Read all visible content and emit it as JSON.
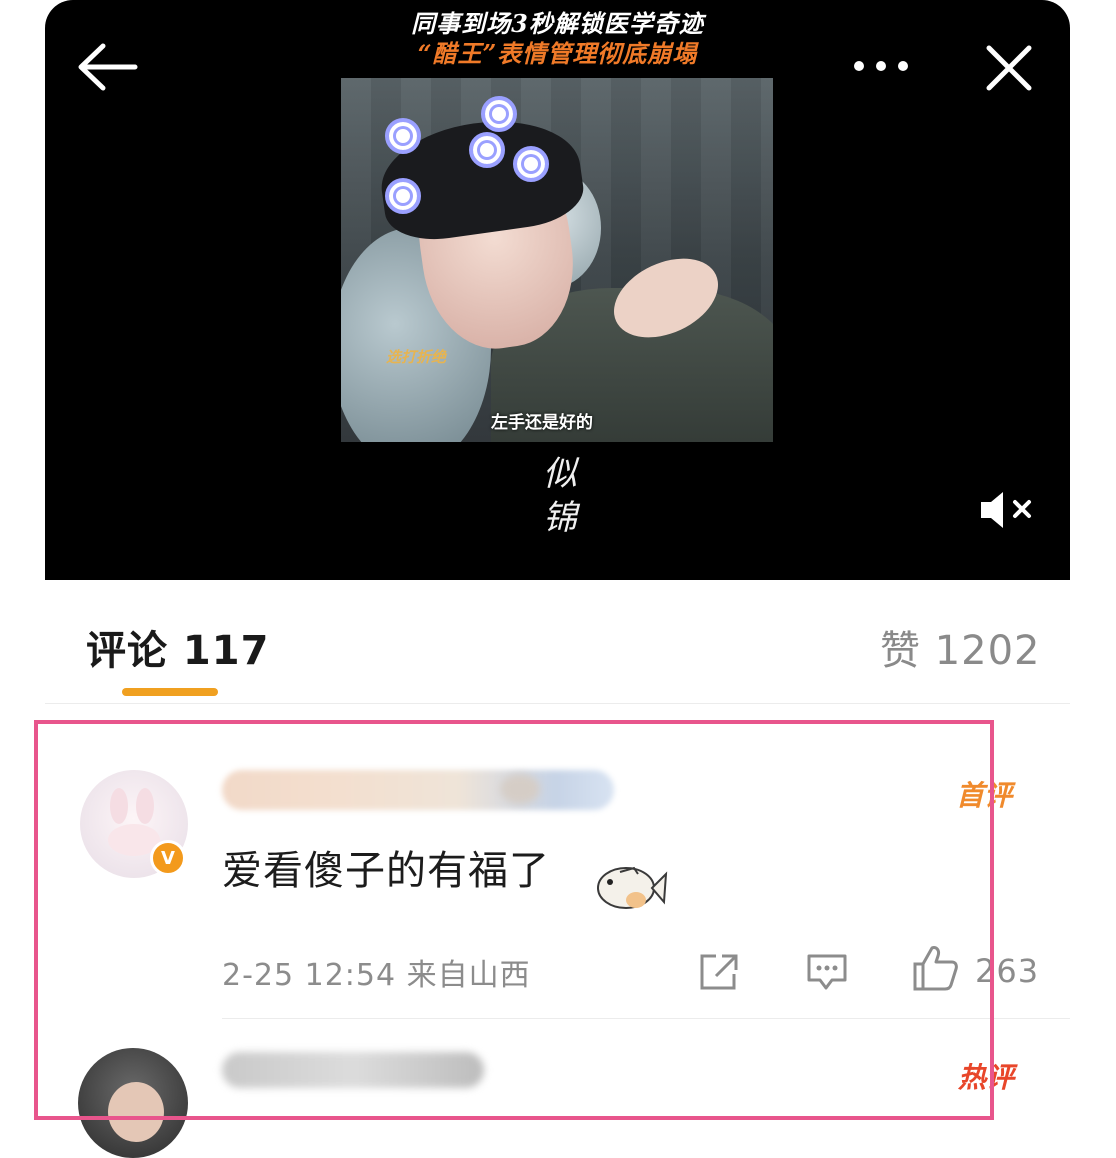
{
  "video": {
    "caption_line1": "同事到场3秒解锁医学奇迹",
    "caption_line2": "“醋王”表情管理彻底崩塌",
    "frame_subtitle_left": "选打折绝",
    "frame_subtitle_bottom": "左手还是好的",
    "logo_text": "似锦",
    "icons": {
      "back": "arrow-left-icon",
      "more": "more-dots-icon",
      "close": "close-icon",
      "mute": "speaker-muted-icon"
    }
  },
  "tabs": {
    "comments_label": "评论 117",
    "likes_label": "赞 1202",
    "accent_color": "#f0a020"
  },
  "comments": [
    {
      "badge_text": "V",
      "tag": "首评",
      "text": "爱看傻子的有福了",
      "meta": "2-25 12:54 来自山西",
      "like_count": "263",
      "icons": {
        "emoji": "fish-emoji-icon",
        "share": "share-icon",
        "reply": "reply-icon",
        "like": "thumbs-up-icon"
      }
    },
    {
      "tag": "热评"
    }
  ],
  "colors": {
    "highlight_border": "#e8558c",
    "tag_orange": "#f08a2c",
    "tag_red": "#e8462a"
  }
}
